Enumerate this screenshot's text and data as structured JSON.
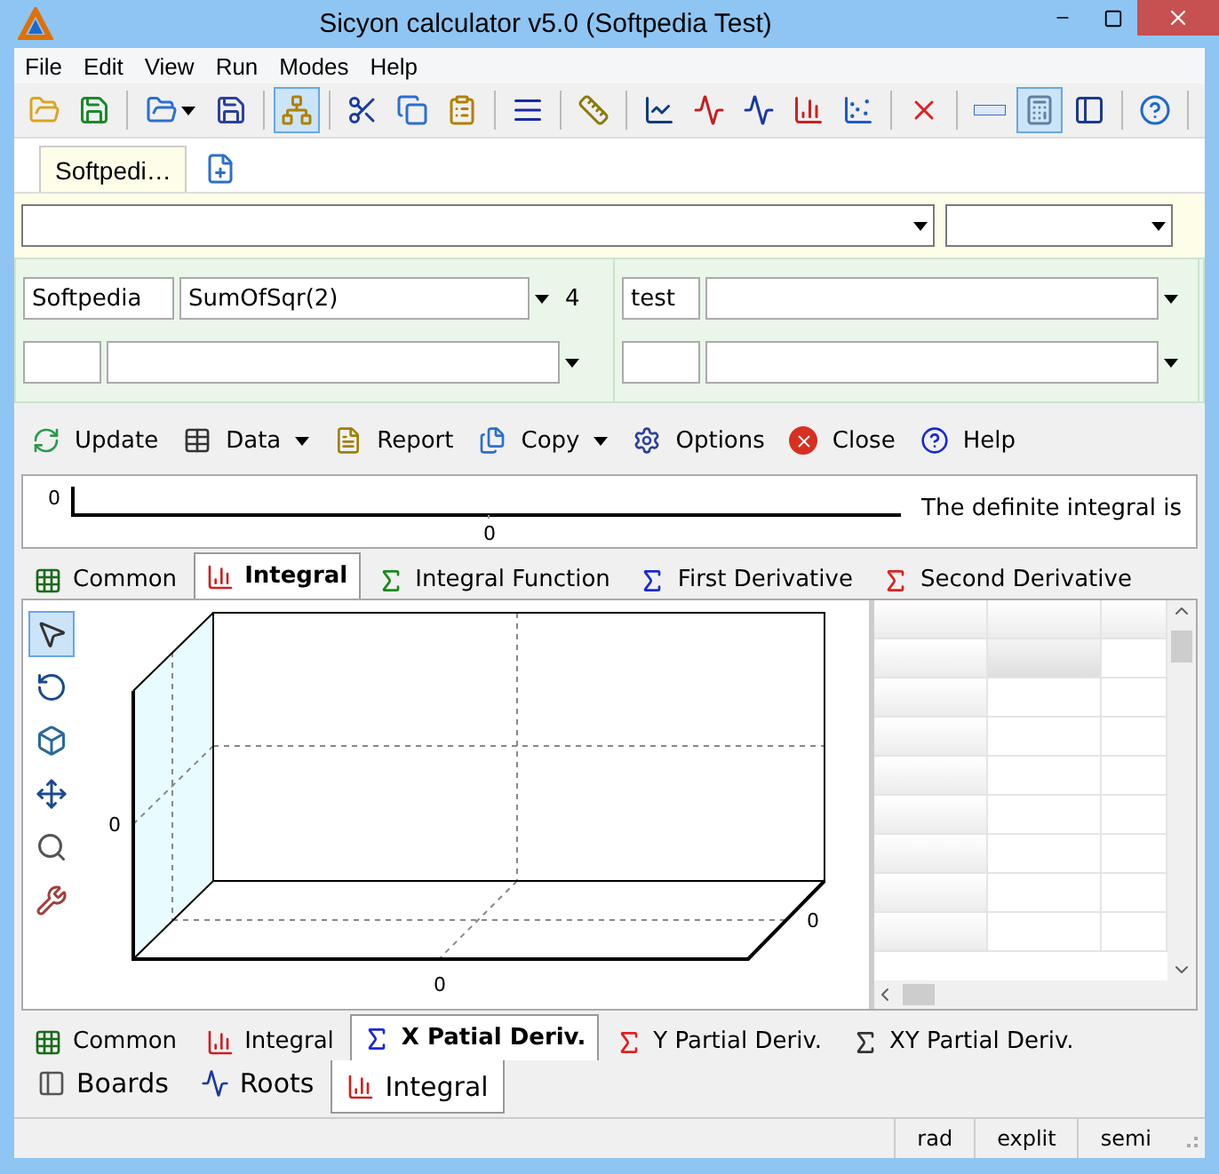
{
  "window": {
    "title": "Sicyon calculator v5.0 (Softpedia Test)"
  },
  "menu": [
    "File",
    "Edit",
    "View",
    "Run",
    "Modes",
    "Help"
  ],
  "toolbar": [
    [
      {
        "kind": "button",
        "pressed": false
      },
      {
        "kind": "button",
        "pressed": false
      }
    ],
    [
      {
        "kind": "menu-button",
        "pressed": false
      },
      {
        "kind": "button",
        "pressed": false
      }
    ],
    [
      {
        "kind": "button",
        "pressed": true
      }
    ],
    [
      {
        "kind": "button",
        "pressed": false
      },
      {
        "kind": "button",
        "pressed": false
      },
      {
        "kind": "button",
        "pressed": false
      }
    ],
    [
      {
        "kind": "button",
        "pressed": false
      }
    ],
    [
      {
        "kind": "button",
        "pressed": false
      }
    ],
    [
      {
        "kind": "button",
        "pressed": false
      },
      {
        "kind": "button",
        "pressed": false
      },
      {
        "kind": "button",
        "pressed": false
      },
      {
        "kind": "button",
        "pressed": false
      },
      {
        "kind": "button",
        "pressed": false
      }
    ],
    [
      {
        "kind": "button",
        "pressed": false
      }
    ],
    [
      {
        "kind": "button",
        "pressed": false
      },
      {
        "kind": "button",
        "pressed": true
      },
      {
        "kind": "button",
        "pressed": false
      }
    ],
    [
      {
        "kind": "button",
        "pressed": false
      }
    ]
  ],
  "doc_tabs": [
    {
      "label": "Softpedi…",
      "selected": true
    }
  ],
  "formula": {
    "left": {
      "name": "Softpedia",
      "expression": "SumOfSqr(2)",
      "count": "4"
    },
    "right": {
      "name": "test"
    }
  },
  "actions": [
    {
      "label": "Update",
      "has_menu": false
    },
    {
      "label": "Data",
      "has_menu": true
    },
    {
      "label": "Report",
      "has_menu": false
    },
    {
      "label": "Copy",
      "has_menu": true
    },
    {
      "label": "Options",
      "has_menu": false
    },
    {
      "label": "Close",
      "has_menu": false
    },
    {
      "label": "Help",
      "has_menu": false
    }
  ],
  "integral_strip": {
    "y_tick": "0",
    "x_tick": "0",
    "result": "The definite integral is"
  },
  "plot_tabs": [
    {
      "label": "Common",
      "selected": false
    },
    {
      "label": "Integral",
      "selected": true
    },
    {
      "label": "Integral Function",
      "selected": false
    },
    {
      "label": "First Derivative",
      "selected": false
    },
    {
      "label": "Second Derivative",
      "selected": false
    }
  ],
  "plot_tools": [
    {
      "pressed": true
    },
    {
      "pressed": false
    },
    {
      "pressed": false
    },
    {
      "pressed": false
    },
    {
      "pressed": false
    },
    {
      "pressed": false
    }
  ],
  "plot": {
    "y_label": "0",
    "x_label": "0",
    "z_label": "0"
  },
  "lower_tabs": [
    {
      "label": "Common",
      "selected": false
    },
    {
      "label": "Integral",
      "selected": false
    },
    {
      "label": "X Patial Deriv.",
      "selected": true
    },
    {
      "label": "Y Partial Deriv.",
      "selected": false
    },
    {
      "label": "XY Partial Deriv.",
      "selected": false
    }
  ],
  "bottom_tabs": [
    {
      "label": "Boards",
      "selected": false
    },
    {
      "label": "Roots",
      "selected": false
    },
    {
      "label": "Integral",
      "selected": true
    }
  ],
  "status_bar": [
    "rad",
    "explit",
    "semi"
  ]
}
